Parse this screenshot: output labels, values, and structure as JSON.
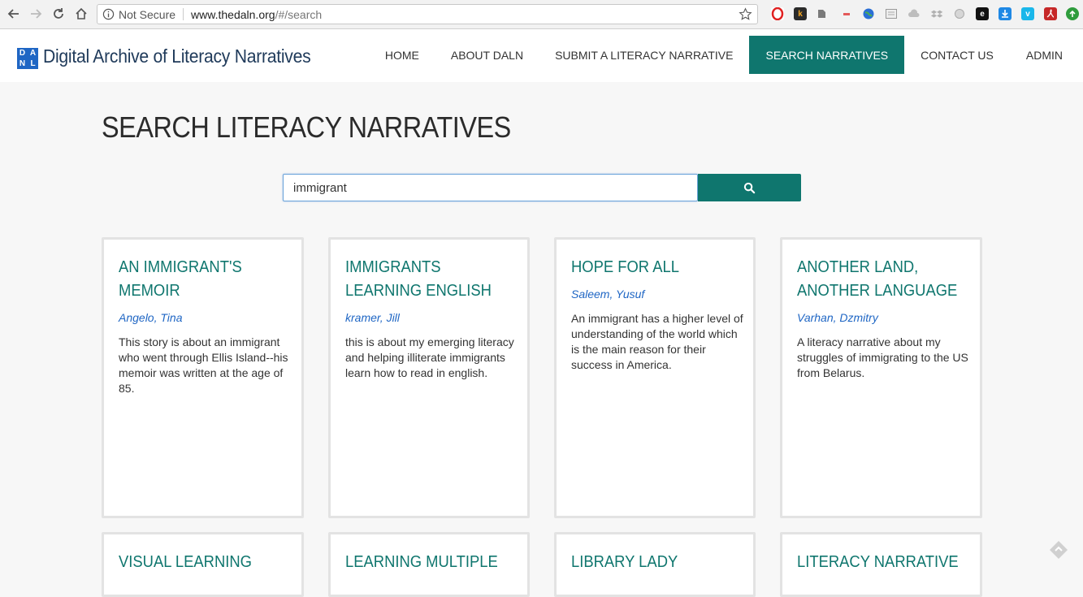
{
  "browser": {
    "security_label": "Not Secure",
    "url_host": "www.thedaln.org",
    "url_path": "/#/search"
  },
  "site": {
    "logo_letters": [
      "D",
      "A",
      "N",
      "L"
    ],
    "title": "Digital Archive of Literacy Narratives"
  },
  "nav": [
    {
      "label": "HOME",
      "active": false
    },
    {
      "label": "ABOUT DALN",
      "active": false
    },
    {
      "label": "SUBMIT A LITERACY NARRATIVE",
      "active": false
    },
    {
      "label": "SEARCH NARRATIVES",
      "active": true
    },
    {
      "label": "CONTACT US",
      "active": false
    },
    {
      "label": "ADMIN",
      "active": false
    }
  ],
  "page": {
    "heading": "SEARCH LITERACY NARRATIVES"
  },
  "search": {
    "value": "immigrant",
    "button_icon": "search-icon"
  },
  "results": [
    {
      "title": "AN IMMIGRANT'S MEMOIR",
      "author": "Angelo, Tina",
      "description": "This story is about an immigrant who went through Ellis Island--his memoir was written at the age of 85."
    },
    {
      "title": "IMMIGRANTS LEARNING ENGLISH",
      "author": "kramer, Jill",
      "description": "this is about my emerging literacy and helping illiterate immigrants learn how to read in english."
    },
    {
      "title": "HOPE FOR ALL",
      "author": "Saleem, Yusuf",
      "description": "An immigrant has a higher level of understanding of the world which is the main reason for their success in America."
    },
    {
      "title": "ANOTHER LAND, ANOTHER LANGUAGE",
      "author": "Varhan, Dzmitry",
      "description": "A literacy narrative about my struggles of immigrating to the US from Belarus."
    },
    {
      "title": "VISUAL LEARNING",
      "author": "",
      "description": ""
    },
    {
      "title": "LEARNING MULTIPLE",
      "author": "",
      "description": ""
    },
    {
      "title": "LIBRARY LADY",
      "author": "",
      "description": ""
    },
    {
      "title": "LITERACY NARRATIVE",
      "author": "",
      "description": ""
    }
  ],
  "colors": {
    "accent": "#0f766e",
    "link": "#1f66c4",
    "logo": "#1f66c4"
  }
}
